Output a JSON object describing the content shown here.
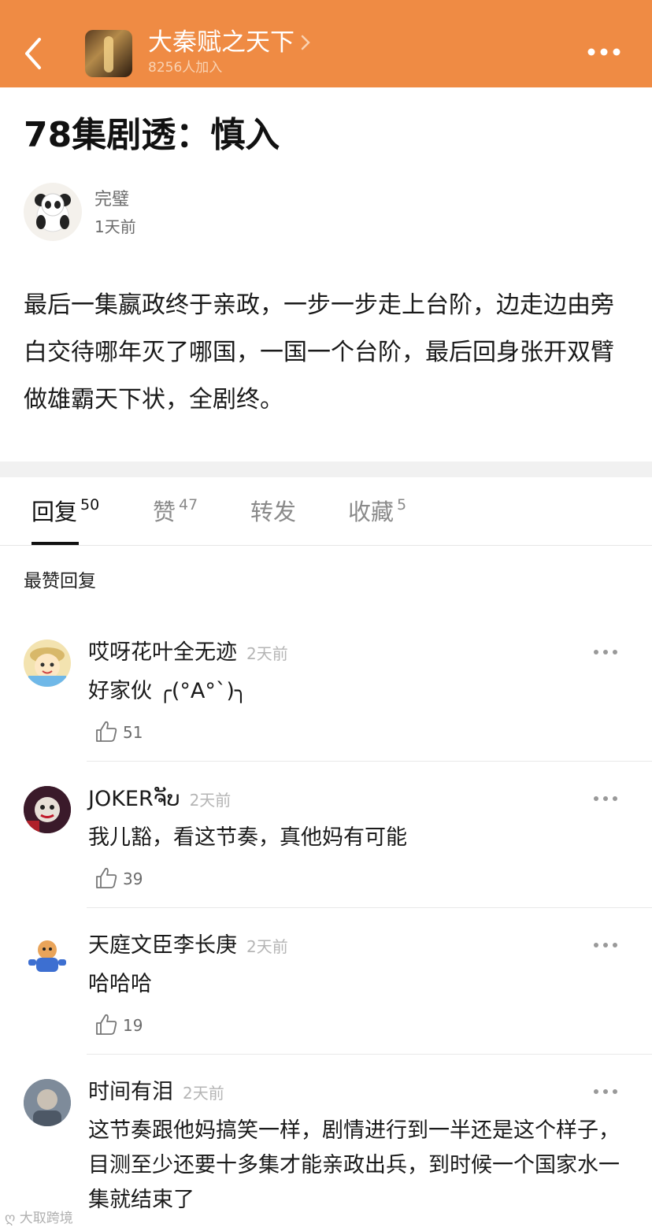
{
  "header": {
    "group_name": "大秦赋之天下",
    "members": "8256人加入"
  },
  "post": {
    "title": "78集剧透：慎入",
    "author": "完璧",
    "time": "1天前",
    "body": "最后一集嬴政终于亲政，一步一步走上台阶，边走边由旁白交待哪年灭了哪国，一国一个台阶，最后回身张开双臂做雄霸天下状，全剧终。"
  },
  "tabs": [
    {
      "label": "回复",
      "count": "50"
    },
    {
      "label": "赞",
      "count": "47"
    },
    {
      "label": "转发",
      "count": ""
    },
    {
      "label": "收藏",
      "count": "5"
    }
  ],
  "section_label": "最赞回复",
  "comments": [
    {
      "name": "哎呀花叶全无迹",
      "time": "2天前",
      "text": "好家伙 ╭(°A°`)╮",
      "likes": "51"
    },
    {
      "name": "JOKERຈັບ",
      "time": "2天前",
      "text": "我儿豁，看这节奏，真他妈有可能",
      "likes": "39"
    },
    {
      "name": "天庭文臣李长庚",
      "time": "2天前",
      "text": "哈哈哈",
      "likes": "19"
    },
    {
      "name": "时间有泪",
      "time": "2天前",
      "text": "这节奏跟他妈搞笑一样，剧情进行到一半还是这个样子，目测至少还要十多集才能亲政出兵，到时候一个国家水一集就结束了",
      "likes": ""
    }
  ],
  "watermark": "大取跨境",
  "colors": {
    "header_bg": "#ef8b44",
    "header_text": "#ffffff"
  }
}
